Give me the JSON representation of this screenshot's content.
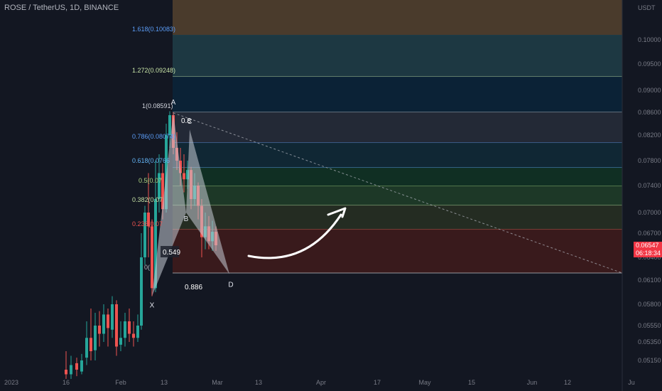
{
  "header": {
    "symbol": "ROSE / TetherUS, 1D, BINANCE"
  },
  "axis": {
    "unit": "USDT",
    "current_price": "0.06547",
    "countdown": "06:18:34"
  },
  "colors": {
    "up": "#26a69a",
    "down": "#ef5350",
    "bg": "#131722"
  },
  "chart_data": {
    "type": "candlestick",
    "y_ticks": [
      "0.10000",
      "0.09500",
      "0.09000",
      "0.08600",
      "0.08200",
      "0.07800",
      "0.07400",
      "0.07000",
      "0.06700",
      "0.06400",
      "0.06100",
      "0.05800",
      "0.05550",
      "0.05350",
      "0.05150"
    ],
    "x_ticks": [
      "2023",
      "16",
      "Feb",
      "13",
      "Mar",
      "13",
      "Apr",
      "17",
      "May",
      "15",
      "Jun",
      "12",
      "Ju"
    ],
    "fib_levels": [
      {
        "label": "1.618(0.10083)",
        "color": "#5b9cf6",
        "fill": "#2a4a5a"
      },
      {
        "label": "1.272(0.09248)",
        "color": "#c5e1a5",
        "fill": "#1d3a44"
      },
      {
        "label": "1(0.08591)",
        "color": "#d1d4dc",
        "fill": "#0b2338"
      },
      {
        "label": "0.786(0.08074)",
        "color": "#5b9cf6",
        "fill": "#242a38"
      },
      {
        "label": "0.618(0.0766",
        "color": "#64b5f6",
        "fill": "#102836"
      },
      {
        "label": "0.5(0.07",
        "color": "#aed581",
        "fill": "#103024"
      },
      {
        "label": "0.382(0.07",
        "color": "#c5e1a5",
        "fill": "#1d3a28"
      },
      {
        "label": "0.236(0.07",
        "color": "#ef5350",
        "fill": "#252d23"
      },
      {
        "label": "0(",
        "color": "#b2b5be",
        "fill": "#3b1a1c"
      }
    ],
    "pattern_points": [
      {
        "label": "X",
        "x": 0.059
      },
      {
        "label": "A",
        "x": 0.08591
      },
      {
        "label": "B",
        "x": 0.07
      },
      {
        "label": "C",
        "x": 0.083
      },
      {
        "label": "D",
        "x": 0.0618
      }
    ],
    "ratios": [
      "0.8",
      "0.549",
      "0.886"
    ]
  }
}
